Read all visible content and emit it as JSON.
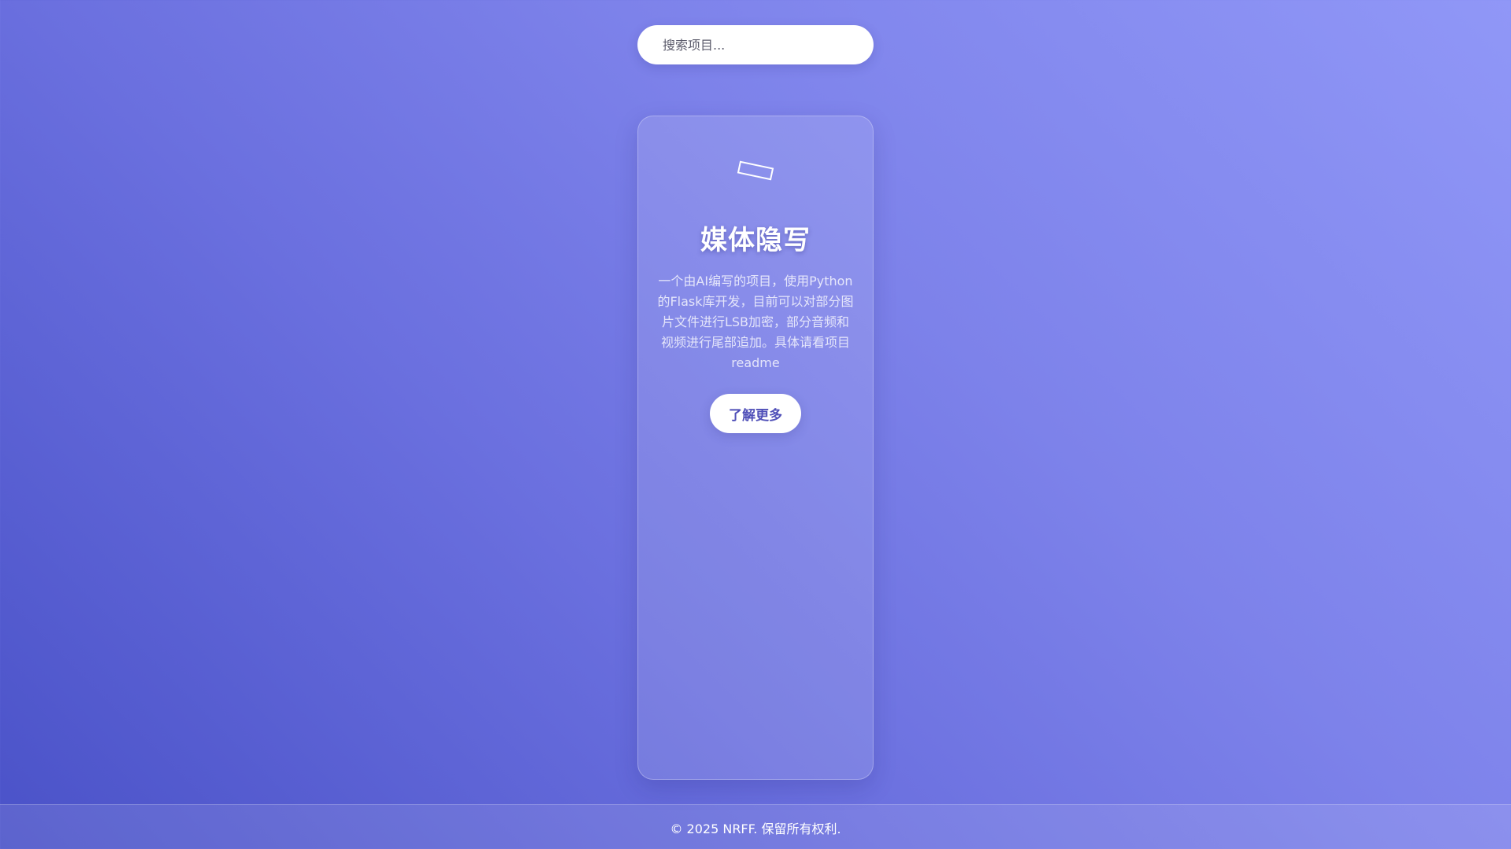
{
  "search": {
    "placeholder": "搜索项目..."
  },
  "card": {
    "icon": "tag-icon",
    "title": "媒体隐写",
    "description": "一个由AI编写的项目，使用Python的Flask库开发，目前可以对部分图片文件进行LSB加密，部分音频和视频进行尾部追加。具体请看项目readme",
    "button_label": "了解更多"
  },
  "footer": {
    "copyright": "© 2025 NRFF. 保留所有权利."
  }
}
